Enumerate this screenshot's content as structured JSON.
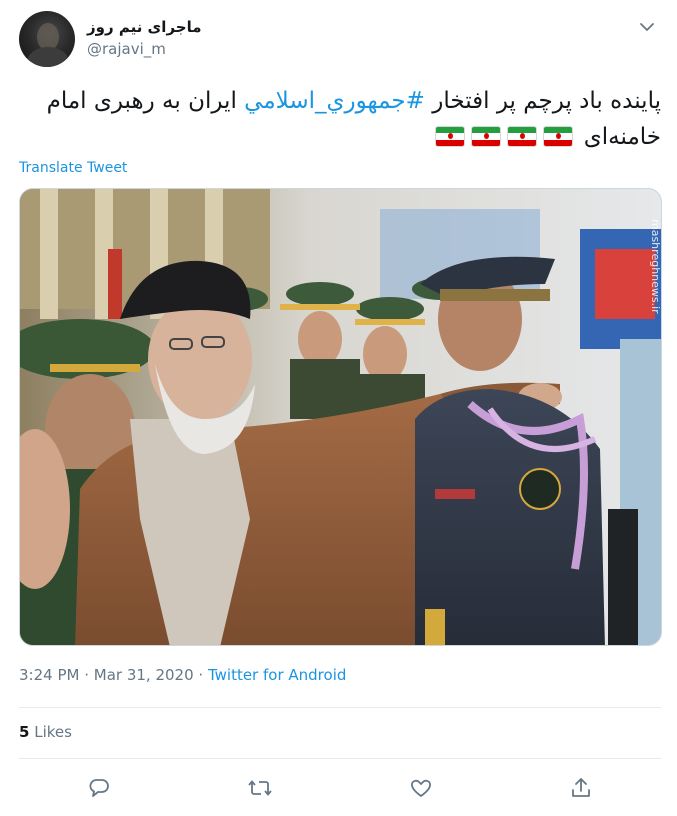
{
  "author": {
    "display_name": "ماجرای نیم روز",
    "handle": "@rajavi_m"
  },
  "tweet": {
    "text_part1": "پاینده باد پرچم پر افتخار ",
    "hashtag": "#جمهوري_اسلامي",
    "text_part2": " ایران به رهبری امام خامنه‌ای ",
    "flag_count": 4,
    "translate_label": "Translate Tweet"
  },
  "media": {
    "watermark": "mashreghnews.ir"
  },
  "meta": {
    "time": "3:24 PM",
    "separator": " · ",
    "date": "Mar 31, 2020",
    "source": "Twitter for Android"
  },
  "stats": {
    "likes_count": "5",
    "likes_label": "Likes"
  },
  "icons": {
    "menu": "chevron-down-icon",
    "reply": "reply-icon",
    "retweet": "retweet-icon",
    "like": "heart-icon",
    "share": "share-icon"
  },
  "colors": {
    "accent": "#1b95e0",
    "muted": "#657786",
    "text": "#14171a"
  }
}
